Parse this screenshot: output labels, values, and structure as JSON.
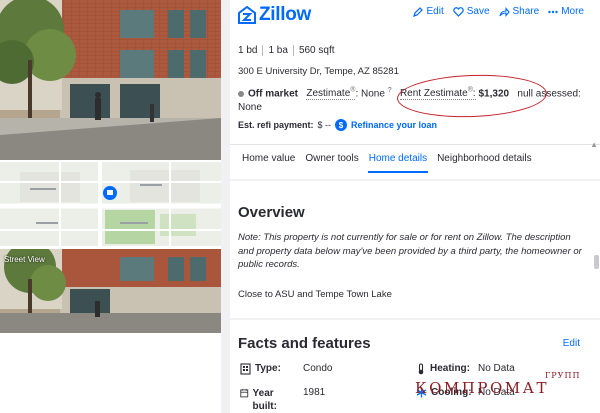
{
  "left": {
    "street_view_label": "Street View"
  },
  "header": {
    "logo_text": "Zillow",
    "actions": [
      {
        "label": "Edit",
        "icon": "pencil-icon"
      },
      {
        "label": "Save",
        "icon": "heart-icon"
      },
      {
        "label": "Share",
        "icon": "share-icon"
      },
      {
        "label": "More",
        "icon": "more-icon"
      }
    ]
  },
  "summary": {
    "beds": "1 bd",
    "baths": "1 ba",
    "sqft": "560 sqft",
    "address": "300 E University Dr, Tempe, AZ 85281",
    "status": "Off market",
    "zestimate_label": "Zestimate",
    "zestimate_reg": "®",
    "zestimate_value": ": None",
    "rent_label": "Rent Zestimate",
    "rent_reg": "®",
    "rent_value": "$1,320",
    "assessed_text": "null assessed:",
    "assessed_value": "None",
    "refi_label": "Est. refi payment:",
    "refi_value": "$ --",
    "refi_link": "Refinance your loan"
  },
  "tabs": [
    "Home value",
    "Owner tools",
    "Home details",
    "Neighborhood details"
  ],
  "active_tab": "Home details",
  "overview": {
    "title": "Overview",
    "note": "Note: This property is not currently for sale or for rent on Zillow. The description and property data below may've been provided by a third party, the homeowner or public records.",
    "description": "Close to ASU and Tempe Town Lake"
  },
  "facts": {
    "title": "Facts and features",
    "edit_label": "Edit",
    "type_label": "Type:",
    "type_value": "Condo",
    "year_label": "Year built:",
    "year_value": "1981",
    "heating_label": "Heating:",
    "heating_value": "No Data",
    "cooling_label": "Cooling:",
    "cooling_value": "No Data"
  },
  "watermark": {
    "small": "ГРУПП",
    "big": "КОМПРОМАТ"
  },
  "colors": {
    "brand": "#006aff",
    "annotation": "#c42129",
    "watermark": "#8c1b22"
  }
}
